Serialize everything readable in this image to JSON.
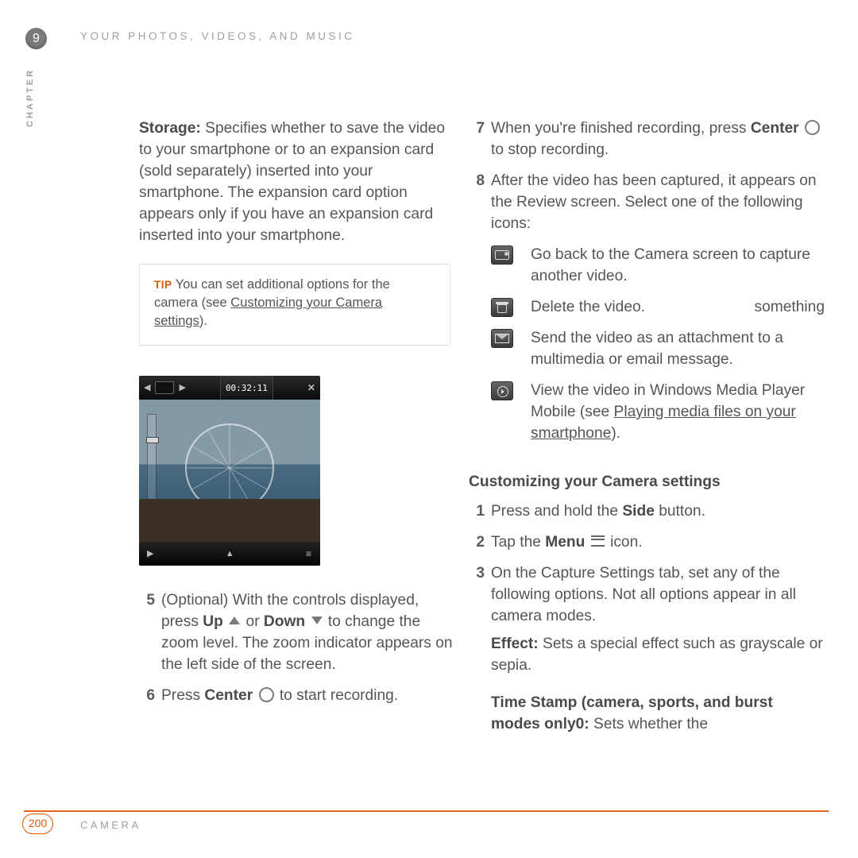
{
  "header": {
    "chapter_number": "9",
    "page_title": "YOUR PHOTOS, VIDEOS, AND MUSIC",
    "chapter_vertical": "CHAPTER"
  },
  "left": {
    "storage_label": "Storage:",
    "storage_body": " Specifies whether to save the video to your smartphone or to an expansion card (sold separately) inserted into your smartphone. The expansion card option appears only if you have an expansion card inserted into your smartphone.",
    "tip_label": "TIP",
    "tip_body_prefix": " You can set additional options for the camera (see ",
    "tip_link": "Customizing your Camera settings",
    "tip_body_suffix": ").",
    "screenshot_timer": "00:32:11",
    "list": {
      "n5": "5",
      "t5a": "(Optional) With the controls displayed, press ",
      "t5_up": "Up",
      "t5b": " or ",
      "t5_down": "Down",
      "t5c": " to change the zoom level. The zoom indicator appears on the left side of the screen.",
      "n6": "6",
      "t6a": "Press ",
      "t6_center": "Center",
      "t6b": " to start recording."
    }
  },
  "right": {
    "n7": "7",
    "t7a": "When you're finished recording, press ",
    "t7_center": "Center",
    "t7b": " to stop recording.",
    "n8": "8",
    "t8": "After the video has been captured, it appears on the Review screen. Select one of the following icons:",
    "rev": {
      "camera": "Go back to the Camera screen to capture another video.",
      "trash": "Delete the video.",
      "mail": "Send the video as an attachment to a multimedia or email message.",
      "play_prefix": "View the video in Windows Media Player Mobile (see ",
      "play_link": "Playing media files on your smartphone",
      "play_suffix": ")."
    },
    "subheading": "Customizing your Camera settings",
    "c1n": "1",
    "c1a": "Press and hold the ",
    "c1_side": "Side",
    "c1b": " button.",
    "c2n": "2",
    "c2a": "Tap the ",
    "c2_menu": "Menu",
    "c2b": " icon.",
    "c3n": "3",
    "c3": "On the Capture Settings tab, set any of the following options. Not all options appear in all camera modes.",
    "effect_label": "Effect:",
    "effect_body": " Sets a special effect such as grayscale or sepia.",
    "timestamp_label": "Time Stamp (camera, sports, and burst modes only0:",
    "timestamp_body": " Sets whether the"
  },
  "footer": {
    "page_number": "200",
    "section": "CAMERA"
  }
}
